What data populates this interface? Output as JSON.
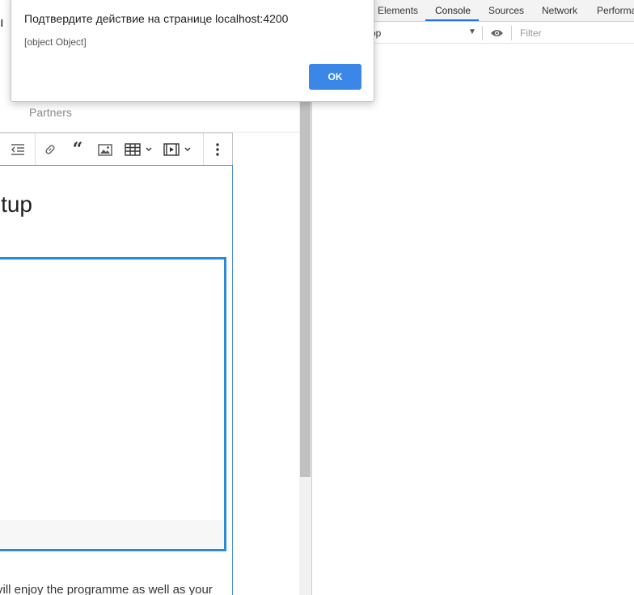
{
  "page": {
    "partial_top_char": "ı",
    "nav_item_partners": "Partners",
    "editor": {
      "heading_fragment": "tup",
      "paragraph_fragment": "vill enjoy the programme as well as your"
    }
  },
  "toolbar": {
    "icons": [
      "outdent-icon",
      "link-icon",
      "blockquote-icon",
      "image-icon",
      "table-icon",
      "media-icon",
      "more-icon"
    ]
  },
  "devtools": {
    "tabs": [
      "Elements",
      "Console",
      "Sources",
      "Network",
      "Performa"
    ],
    "active_tab": "Console",
    "context_fragment": "op",
    "filter_placeholder": "Filter"
  },
  "dialog": {
    "title": "Подтвердите действие на странице localhost:4200",
    "message": "[object Object]",
    "ok_label": "OK"
  },
  "colors": {
    "accent": "#3b87e8",
    "editor_focus_border": "#2b8bd6",
    "devtools_tab_underline": "#1a73e8"
  }
}
